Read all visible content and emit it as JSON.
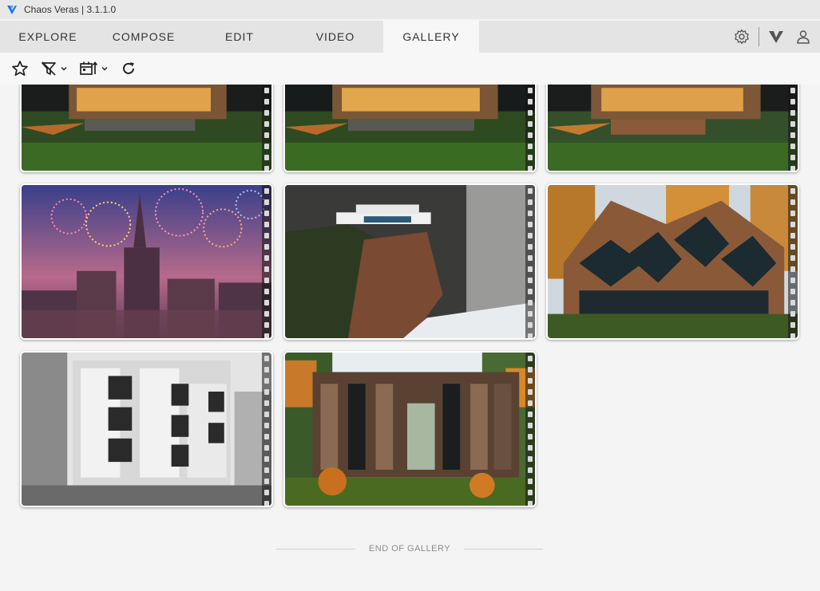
{
  "window": {
    "title": "Chaos Veras | 3.1.1.0"
  },
  "tabs": [
    {
      "label": "EXPLORE"
    },
    {
      "label": "COMPOSE"
    },
    {
      "label": "EDIT"
    },
    {
      "label": "VIDEO"
    },
    {
      "label": "GALLERY",
      "active": true
    }
  ],
  "top_icons": [
    "settings-gear-icon",
    "veras-logo-icon",
    "user-account-icon"
  ],
  "toolbar": {
    "icons": [
      "star-favorite-icon",
      "filter-off-icon",
      "calendar-sort-icon",
      "refresh-icon"
    ]
  },
  "gallery": {
    "items": [
      {
        "subject": "house-night-1"
      },
      {
        "subject": "house-night-2"
      },
      {
        "subject": "house-night-3"
      },
      {
        "subject": "fireworks-city"
      },
      {
        "subject": "cliff-house"
      },
      {
        "subject": "hexagon-wood-house"
      },
      {
        "subject": "concrete-apartments"
      },
      {
        "subject": "wood-cabin-forest"
      }
    ],
    "end_label": "END OF GALLERY"
  },
  "colors": {
    "accent": "#1a73e8",
    "tab_bar": "#e4e4e4",
    "active_tab": "#f7f7f7",
    "background": "#f4f4f4"
  }
}
